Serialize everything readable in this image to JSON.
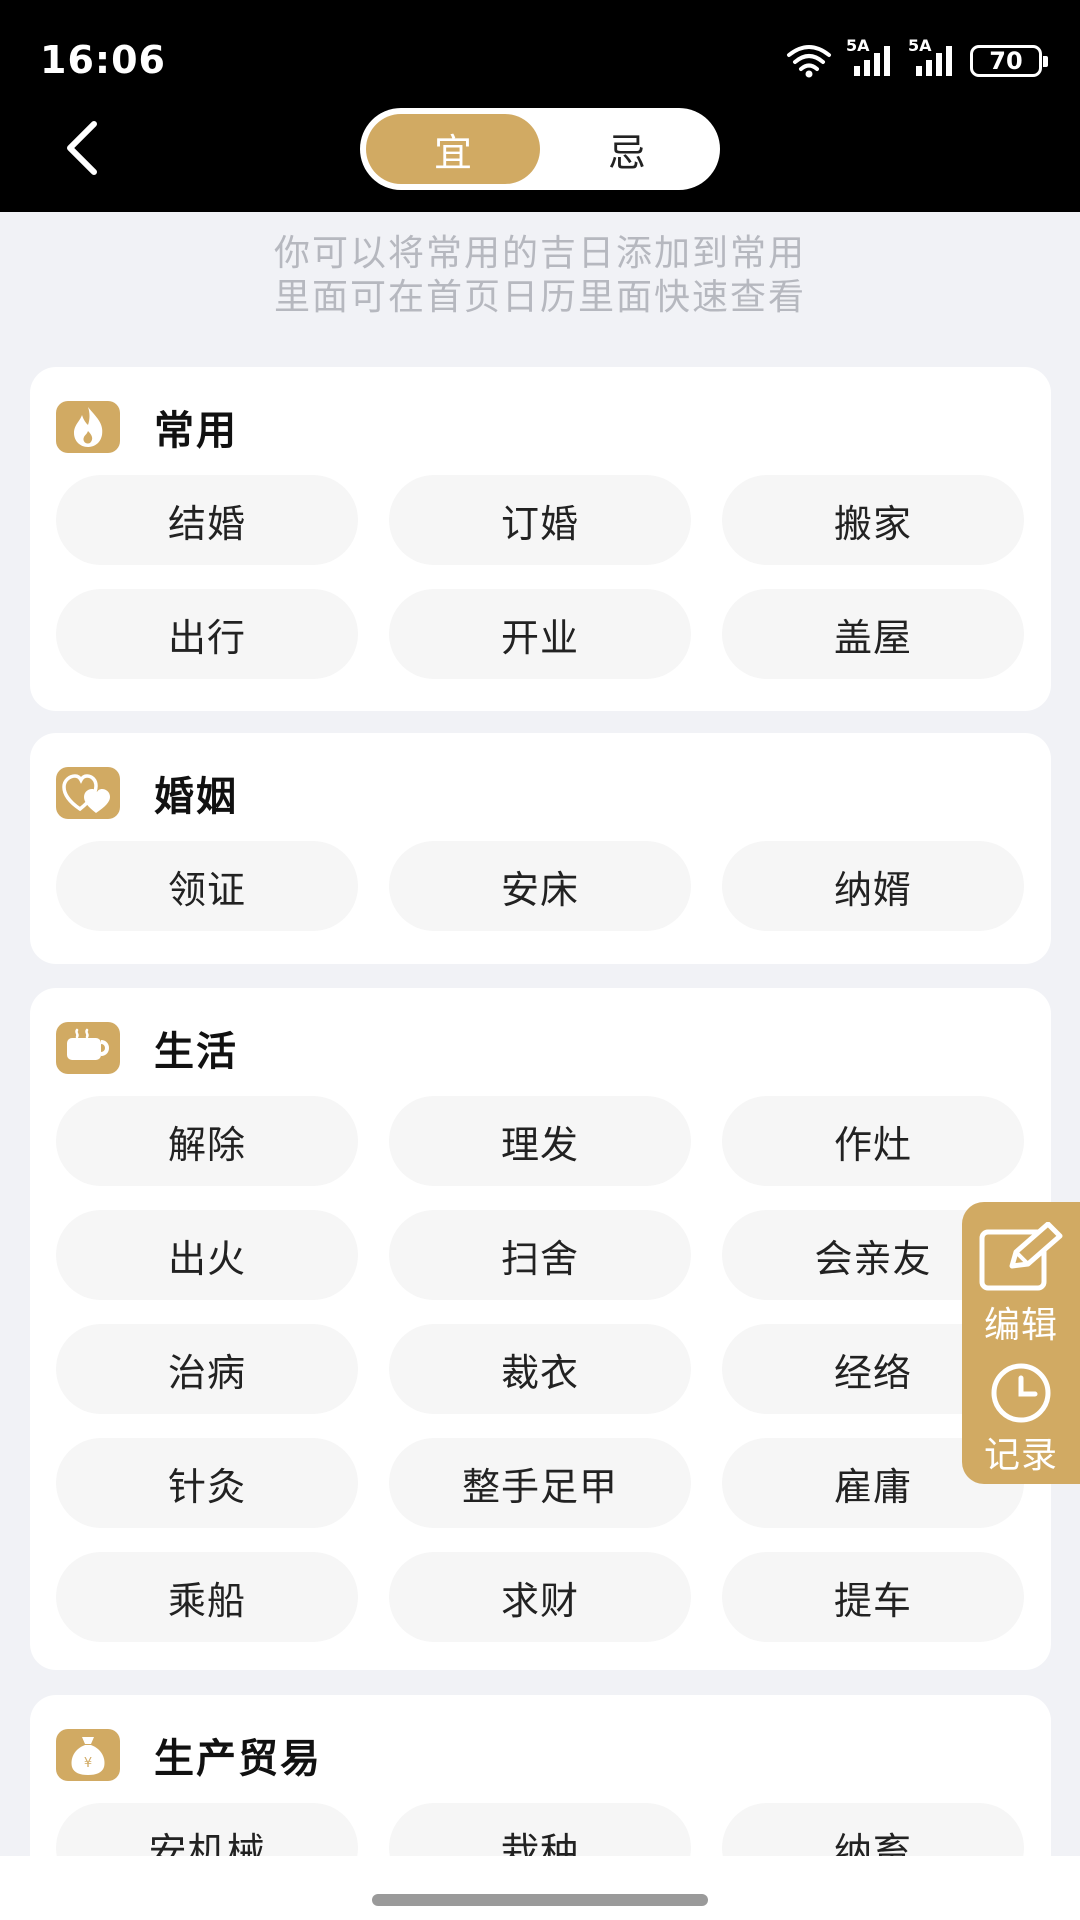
{
  "status_bar": {
    "time": "16:06",
    "signal_1": "5A",
    "signal_2": "5A",
    "battery": "70"
  },
  "header": {
    "back_icon": "chevron-left-icon",
    "tabs": [
      {
        "label": "宜",
        "active": true
      },
      {
        "label": "忌",
        "active": false
      }
    ]
  },
  "hint": {
    "line1": "你可以将常用的吉日添加到常用",
    "line2": "里面可在首页日历里面快速查看"
  },
  "categories": [
    {
      "title": "常用",
      "icon": "flame-icon",
      "items": [
        "结婚",
        "订婚",
        "搬家",
        "出行",
        "开业",
        "盖屋"
      ]
    },
    {
      "title": "婚姻",
      "icon": "hearts-icon",
      "items": [
        "领证",
        "安床",
        "纳婿"
      ]
    },
    {
      "title": "生活",
      "icon": "cup-icon",
      "items": [
        "解除",
        "理发",
        "作灶",
        "出火",
        "扫舍",
        "会亲友",
        "治病",
        "裁衣",
        "经络",
        "针灸",
        "整手足甲",
        "雇庸",
        "乘船",
        "求财",
        "提车"
      ]
    },
    {
      "title": "生产贸易",
      "icon": "money-bag-icon",
      "items": [
        "安机械",
        "栽种",
        "纳畜"
      ]
    }
  ],
  "side_panel": {
    "edit_label": "编辑",
    "record_label": "记录"
  },
  "colors": {
    "accent": "#d1aa63",
    "background": "#f1f2f6",
    "chip": "#f6f6f6",
    "hint_text": "#b6b8bf"
  }
}
